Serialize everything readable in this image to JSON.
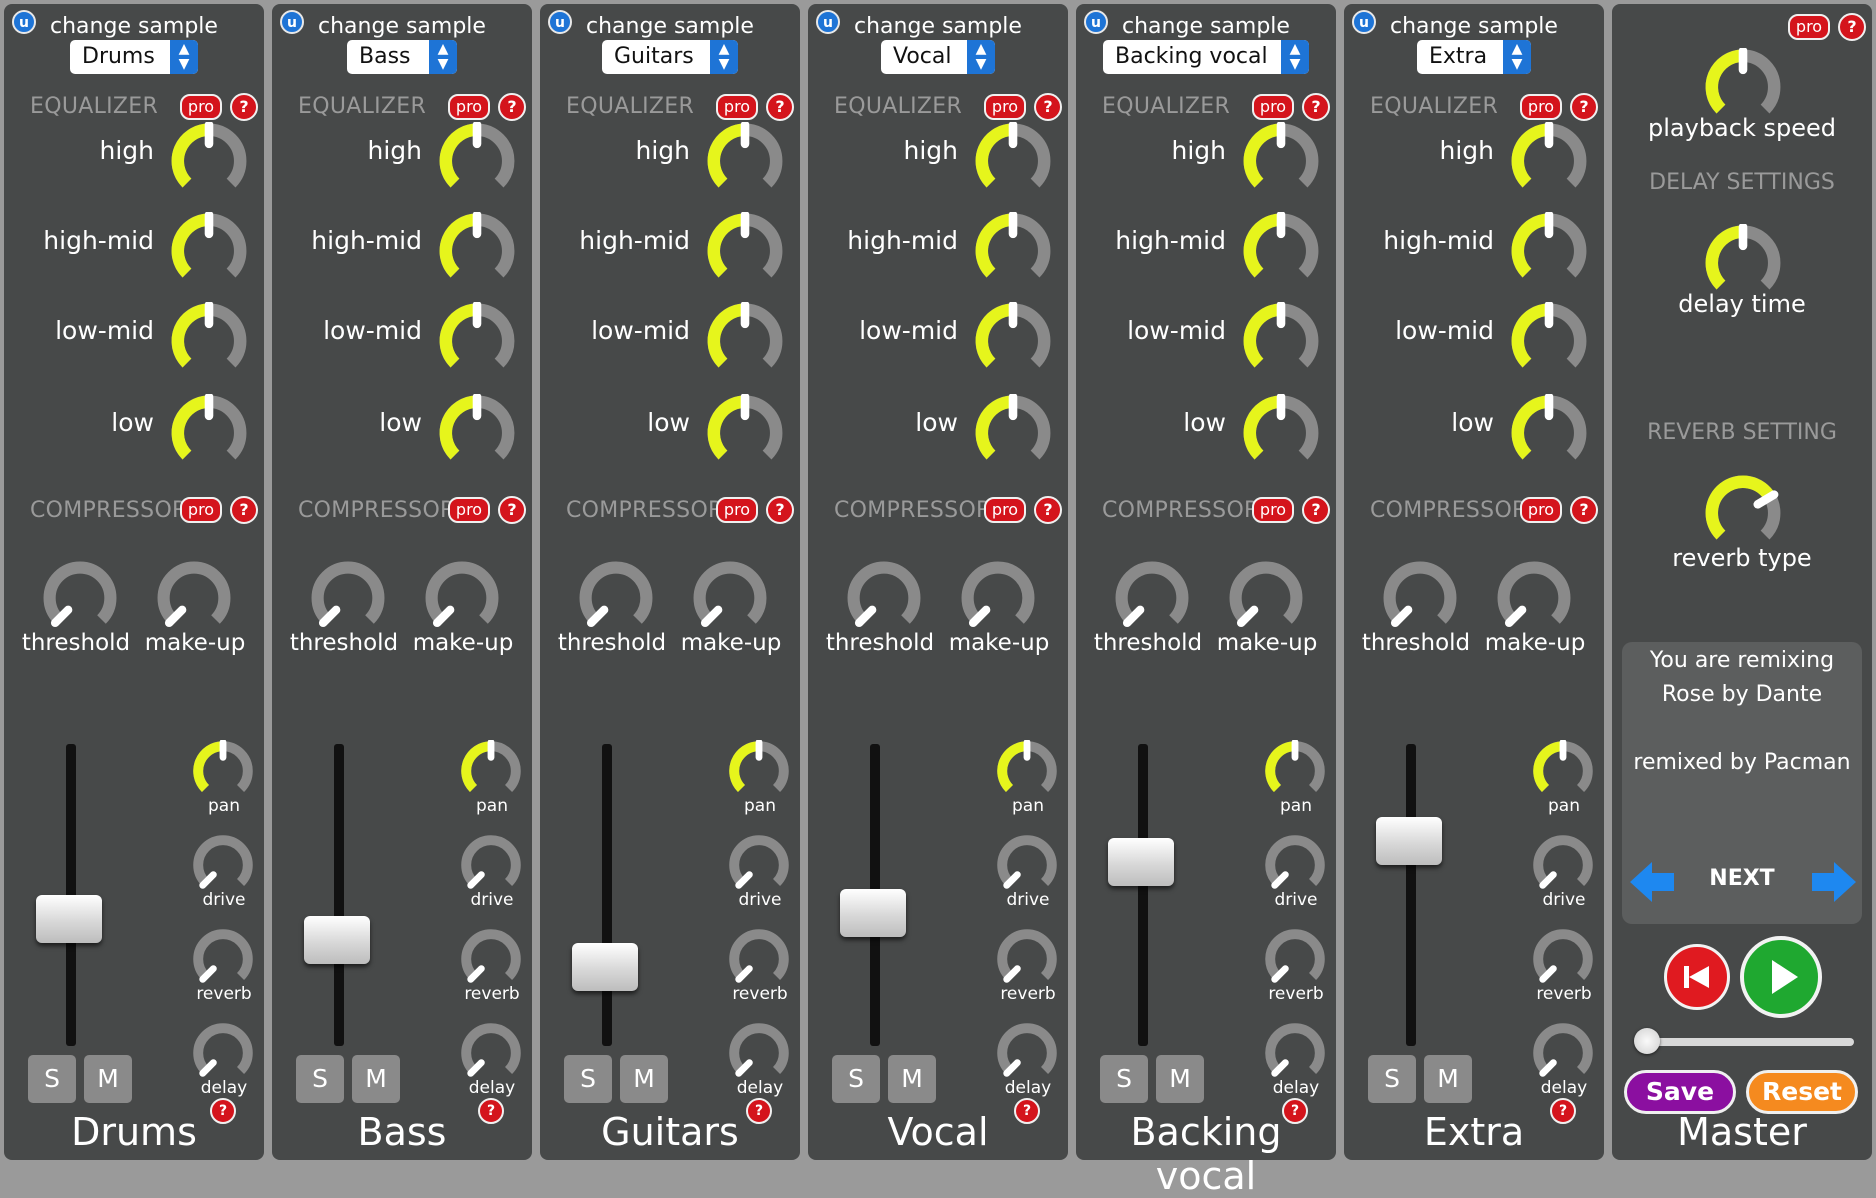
{
  "strips": [
    {
      "change_label": "change sample",
      "sample": "Drums",
      "name": "Drums",
      "eq_title": "EQUALIZER",
      "comp_title": "COMPRESSOR",
      "pro": "pro",
      "help": "?",
      "u": "u",
      "eq": [
        {
          "label": "high"
        },
        {
          "label": "high-mid"
        },
        {
          "label": "low-mid"
        },
        {
          "label": "low"
        }
      ],
      "comp": [
        {
          "label": "threshold"
        },
        {
          "label": "make-up"
        }
      ],
      "fader_level": 0.42,
      "sends": [
        {
          "label": "pan"
        },
        {
          "label": "drive"
        },
        {
          "label": "reverb"
        },
        {
          "label": "delay"
        }
      ],
      "solo": "S",
      "mute": "M"
    },
    {
      "change_label": "change sample",
      "sample": "Bass",
      "name": "Bass",
      "eq_title": "EQUALIZER",
      "comp_title": "COMPRESSOR",
      "pro": "pro",
      "help": "?",
      "u": "u",
      "eq": [
        {
          "label": "high"
        },
        {
          "label": "high-mid"
        },
        {
          "label": "low-mid"
        },
        {
          "label": "low"
        }
      ],
      "comp": [
        {
          "label": "threshold"
        },
        {
          "label": "make-up"
        }
      ],
      "fader_level": 0.35,
      "sends": [
        {
          "label": "pan"
        },
        {
          "label": "drive"
        },
        {
          "label": "reverb"
        },
        {
          "label": "delay"
        }
      ],
      "solo": "S",
      "mute": "M"
    },
    {
      "change_label": "change sample",
      "sample": "Guitars",
      "name": "Guitars",
      "eq_title": "EQUALIZER",
      "comp_title": "COMPRESSOR",
      "pro": "pro",
      "help": "?",
      "u": "u",
      "eq": [
        {
          "label": "high"
        },
        {
          "label": "high-mid"
        },
        {
          "label": "low-mid"
        },
        {
          "label": "low"
        }
      ],
      "comp": [
        {
          "label": "threshold"
        },
        {
          "label": "make-up"
        }
      ],
      "fader_level": 0.26,
      "sends": [
        {
          "label": "pan"
        },
        {
          "label": "drive"
        },
        {
          "label": "reverb"
        },
        {
          "label": "delay"
        }
      ],
      "solo": "S",
      "mute": "M"
    },
    {
      "change_label": "change sample",
      "sample": "Vocal",
      "name": "Vocal",
      "eq_title": "EQUALIZER",
      "comp_title": "COMPRESSOR",
      "pro": "pro",
      "help": "?",
      "u": "u",
      "eq": [
        {
          "label": "high"
        },
        {
          "label": "high-mid"
        },
        {
          "label": "low-mid"
        },
        {
          "label": "low"
        }
      ],
      "comp": [
        {
          "label": "threshold"
        },
        {
          "label": "make-up"
        }
      ],
      "fader_level": 0.44,
      "sends": [
        {
          "label": "pan"
        },
        {
          "label": "drive"
        },
        {
          "label": "reverb"
        },
        {
          "label": "delay"
        }
      ],
      "solo": "S",
      "mute": "M"
    },
    {
      "change_label": "change sample",
      "sample": "Backing vocal",
      "name": "Backing vocal",
      "eq_title": "EQUALIZER",
      "comp_title": "COMPRESSOR",
      "pro": "pro",
      "help": "?",
      "u": "u",
      "eq": [
        {
          "label": "high"
        },
        {
          "label": "high-mid"
        },
        {
          "label": "low-mid"
        },
        {
          "label": "low"
        }
      ],
      "comp": [
        {
          "label": "threshold"
        },
        {
          "label": "make-up"
        }
      ],
      "fader_level": 0.61,
      "sends": [
        {
          "label": "pan"
        },
        {
          "label": "drive"
        },
        {
          "label": "reverb"
        },
        {
          "label": "delay"
        }
      ],
      "solo": "S",
      "mute": "M"
    },
    {
      "change_label": "change sample",
      "sample": "Extra",
      "name": "Extra",
      "eq_title": "EQUALIZER",
      "comp_title": "COMPRESSOR",
      "pro": "pro",
      "help": "?",
      "u": "u",
      "eq": [
        {
          "label": "high"
        },
        {
          "label": "high-mid"
        },
        {
          "label": "low-mid"
        },
        {
          "label": "low"
        }
      ],
      "comp": [
        {
          "label": "threshold"
        },
        {
          "label": "make-up"
        }
      ],
      "fader_level": 0.68,
      "sends": [
        {
          "label": "pan"
        },
        {
          "label": "drive"
        },
        {
          "label": "reverb"
        },
        {
          "label": "delay"
        }
      ],
      "solo": "S",
      "mute": "M"
    }
  ],
  "master": {
    "pro": "pro",
    "playback_speed": "playback speed",
    "delay_settings": "DELAY SETTINGS",
    "delay_time": "delay time",
    "reverb_setting": "REVERB SETTING",
    "reverb_type": "reverb type",
    "info_line1": "You are remixing",
    "info_line2": "Rose by Dante",
    "info_line3": "remixed by Pacman",
    "next": "NEXT",
    "save": "Save",
    "reset": "Reset",
    "name": "Master",
    "position": 0.0
  },
  "colors": {
    "strip_bg": "#474949",
    "knob_active": "#e6f51c",
    "knob_inactive": "#8a8a8a",
    "pro_red": "#d4141c",
    "accent_blue": "#1e74d6",
    "save_purple": "#8b0fa0",
    "reset_orange": "#f58a1f",
    "play_green": "#1fa830"
  }
}
